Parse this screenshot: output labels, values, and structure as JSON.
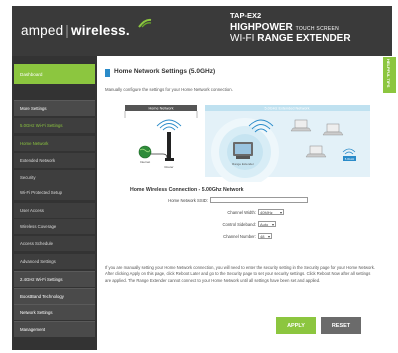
{
  "brand": {
    "logo_left": "amped",
    "logo_bar": "|",
    "logo_right": "wireless.",
    "model": "TAP-EX2",
    "line2_big": "HIGHPOWER",
    "line2_small": "TOUCH SCREEN",
    "line3_a": "WI-FI",
    "line3_b": "RANGE EXTENDER",
    "accent": "#8cc63f"
  },
  "help_tab": "HELPFUL TIPS",
  "sidebar": {
    "dashboard": "Dashboard",
    "items": [
      {
        "label": "More Settings",
        "kind": "main"
      },
      {
        "label": "5.0GHz Wi-Fi Settings",
        "kind": "sub",
        "state": "active"
      },
      {
        "label": "Home Network",
        "kind": "sub",
        "state": "active"
      },
      {
        "label": "Extended Network",
        "kind": "sub"
      },
      {
        "label": "Security",
        "kind": "sub"
      },
      {
        "label": "Wi-Fi Protected Setup",
        "kind": "sub"
      },
      {
        "label": "User Access",
        "kind": "sub"
      },
      {
        "label": "Wireless Coverage",
        "kind": "sub"
      },
      {
        "label": "Access Schedule",
        "kind": "sub"
      },
      {
        "label": "Advanced Settings",
        "kind": "sub"
      },
      {
        "label": "2.4GHz Wi-Fi Settings",
        "kind": "main"
      },
      {
        "label": "BoostBand Technology",
        "kind": "main"
      },
      {
        "label": "Network Settings",
        "kind": "main"
      },
      {
        "label": "Management",
        "kind": "main"
      }
    ]
  },
  "main": {
    "title": "Home Network Settings (5.0GHz)",
    "description": "Manually configure the settings for your Home Network connection.",
    "diagram": {
      "home_label": "Home Network",
      "ext_label": "5.0GHz Extended Network",
      "router_label": "Router",
      "internet_label": "Internet",
      "extender_label": "Range Extender",
      "badge": "5.0GHz"
    },
    "form_title": "Home Wireless Connection - 5.00Ghz Network",
    "fields": {
      "ssid_label": "Home Network SSID:",
      "ssid_value": "",
      "width_label": "Channel Width:",
      "width_value": "40MHz",
      "sideband_label": "Control Sideband:",
      "sideband_value": "Auto",
      "channel_label": "Channel Number:",
      "channel_value": "48"
    },
    "note": "If you are manually setting your Home Network connection, you will need to enter the security setting in the Security page for your Home Network. After clicking Apply on this page, click Reboot Later and go to the Security page to set your security settings. Click Reboot Now after all settings are applied. The Range Extender cannot connect to your Home Network until all settings have been set and applied.",
    "apply_label": "APPLY",
    "reset_label": "RESET"
  }
}
